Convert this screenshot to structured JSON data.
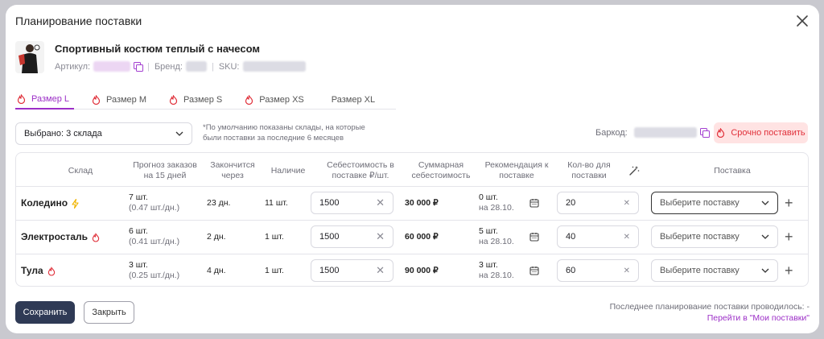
{
  "modal": {
    "title": "Планирование поставки"
  },
  "product": {
    "name": "Спортивный костюм теплый с начесом",
    "article_label": "Артикул:",
    "brand_label": "Бренд:",
    "sku_label": "SKU:"
  },
  "tabs": [
    {
      "label": "Размер L",
      "fire": true,
      "active": true
    },
    {
      "label": "Размер M",
      "fire": true
    },
    {
      "label": "Размер S",
      "fire": true
    },
    {
      "label": "Размер XS",
      "fire": true
    },
    {
      "label": "Размер XL",
      "fire": false
    }
  ],
  "filter": {
    "selected": "Выбрано: 3 склада",
    "note": "*По умолчанию показаны склады, на которые были поставки за последние 6 месяцев"
  },
  "barcode_label": "Баркод:",
  "urgent_button": "Срочно поставить",
  "table": {
    "headers": {
      "warehouse": "Склад",
      "forecast": "Прогноз заказов на 15 дней",
      "runs_out": "Закончится через",
      "stock": "Наличие",
      "cost": "Себестоимость в поставке ₽/шт.",
      "total_cost": "Суммарная себестоимость",
      "recommendation": "Рекомендация к поставке",
      "qty": "Кол-во для поставки",
      "supply": "Поставка"
    },
    "rows": [
      {
        "warehouse": "Коледино",
        "icon": "lightning-icon",
        "forecast": "7 шт.",
        "forecast_sub": "(0.47 шт./дн.)",
        "runs_out": "23 дн.",
        "stock": "11 шт.",
        "cost": "1500",
        "total": "30 000 ₽",
        "rec": "0 шт.",
        "rec_date": "на 28.10.",
        "qty": "20",
        "supply_placeholder": "Выберите поставку"
      },
      {
        "warehouse": "Электросталь",
        "icon": "fire-icon",
        "forecast": "6 шт.",
        "forecast_sub": "(0.41 шт./дн.)",
        "runs_out": "2 дн.",
        "stock": "1 шт.",
        "cost": "1500",
        "total": "60 000 ₽",
        "rec": "5 шт.",
        "rec_date": "на 28.10.",
        "qty": "40",
        "supply_placeholder": "Выберите поставку"
      },
      {
        "warehouse": "Тула",
        "icon": "fire-icon",
        "forecast": "3 шт.",
        "forecast_sub": "(0.25 шт./дн.)",
        "runs_out": "4 дн.",
        "stock": "1 шт.",
        "cost": "1500",
        "total": "90 000 ₽",
        "rec": "3 шт.",
        "rec_date": "на 28.10.",
        "qty": "60",
        "supply_placeholder": "Выберите поставку"
      }
    ]
  },
  "footer": {
    "save": "Сохранить",
    "close": "Закрыть",
    "last_planning": "Последнее планирование поставки проводилось: -",
    "link": "Перейти в \"Мои поставки\""
  },
  "colors": {
    "accent": "#9c2fc7",
    "primary": "#2f3a55",
    "danger": "#e0303a",
    "urgent_bg": "#ffe3e3",
    "lightning": "#f0b400"
  }
}
